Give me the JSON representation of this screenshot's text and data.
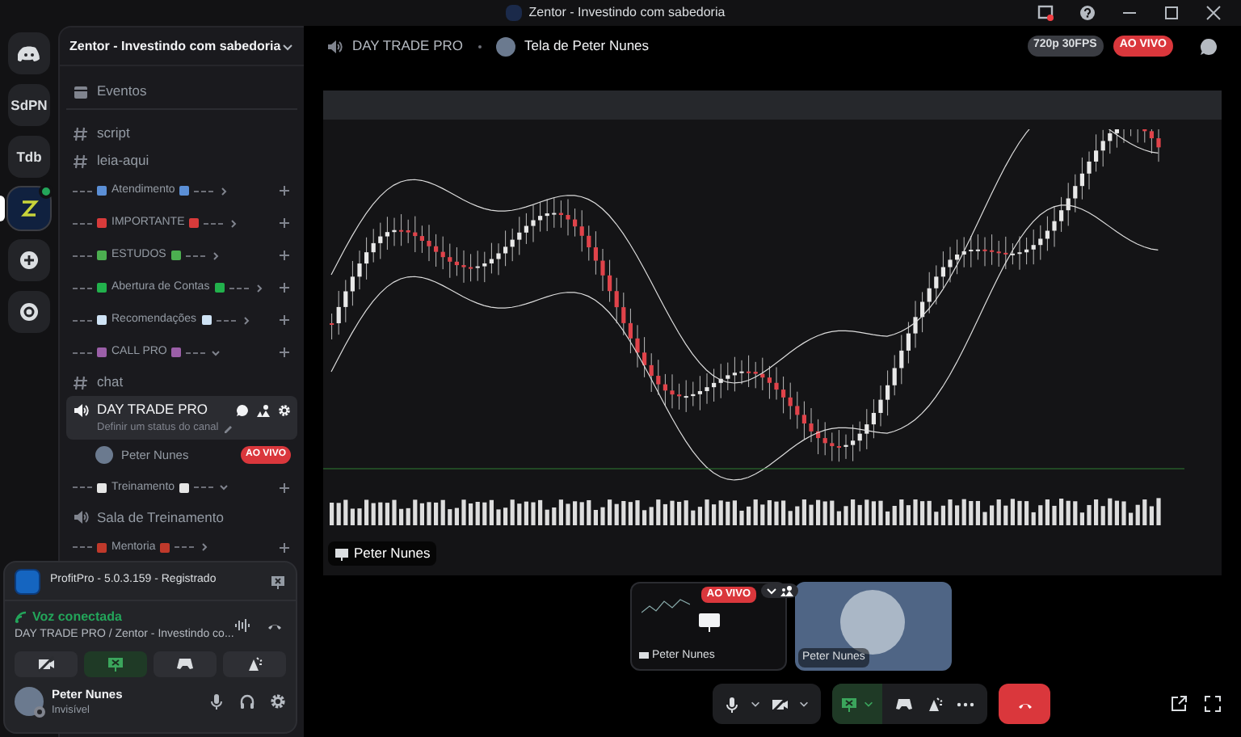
{
  "window": {
    "title": "Zentor - Investindo com sabedoria"
  },
  "servers": [
    {
      "kind": "home",
      "selected": false
    },
    {
      "kind": "text",
      "label": "SdPN",
      "selected": false
    },
    {
      "kind": "text",
      "label": "Tdb",
      "selected": false
    },
    {
      "kind": "image",
      "selected": true
    },
    {
      "kind": "add",
      "selected": false
    },
    {
      "kind": "discover",
      "selected": false
    }
  ],
  "server_name": "Zentor - Investindo com sabedoria",
  "channels": [
    {
      "kind": "event",
      "label": "Eventos"
    },
    {
      "kind": "text",
      "label": "script"
    },
    {
      "kind": "text",
      "label": "leia-aqui"
    },
    {
      "kind": "category",
      "label": "Atendimento",
      "color": "#5b8fd6",
      "expanded": false
    },
    {
      "kind": "category",
      "label": "IMPORTANTE",
      "color": "#d83b3b",
      "expanded": false
    },
    {
      "kind": "category",
      "label": "ESTUDOS",
      "color": "#4caf50",
      "expanded": false
    },
    {
      "kind": "category",
      "label": "Abertura de Contas",
      "color": "#22b14c",
      "expanded": false
    },
    {
      "kind": "category",
      "label": "Recomendações",
      "color": "#cfe3f5",
      "expanded": false
    },
    {
      "kind": "category",
      "label": "CALL PRO",
      "color": "#9b5fa8",
      "expanded": true
    },
    {
      "kind": "text",
      "label": "chat"
    },
    {
      "kind": "voice",
      "label": "DAY TRADE PRO",
      "selected": true,
      "status_placeholder": "Definir um status do canal",
      "users": [
        {
          "name": "Peter Nunes",
          "badge": "AO VIVO"
        }
      ]
    },
    {
      "kind": "category",
      "label": "Treinamento",
      "color": "#e6e6e6",
      "expanded": true
    },
    {
      "kind": "voice",
      "label": "Sala de Treinamento",
      "selected": false
    },
    {
      "kind": "category",
      "label": "Mentoria",
      "color": "#c0392b",
      "expanded": false
    }
  ],
  "activity": {
    "app": "ProfitPro - 5.0.3.159 - Registrado"
  },
  "voice": {
    "status": "Voz conectada",
    "channel": "DAY TRADE PRO / Zentor - Investindo co..."
  },
  "voice_buttons": [
    {
      "kind": "camera",
      "selected": false
    },
    {
      "kind": "screen",
      "selected": true
    },
    {
      "kind": "game",
      "selected": false
    },
    {
      "kind": "effects",
      "selected": false
    }
  ],
  "user": {
    "name": "Peter Nunes",
    "status": "Invisível"
  },
  "stream_header": {
    "channel": "DAY TRADE PRO",
    "title": "Tela de Peter Nunes",
    "quality": "720p 30FPS",
    "live": "AO VIVO"
  },
  "stream": {
    "label": "Peter Nunes"
  },
  "tiles": [
    {
      "kind": "screen",
      "label": "Peter Nunes",
      "badge": "AO VIVO"
    },
    {
      "kind": "camera",
      "label": "Peter Nunes"
    }
  ],
  "controls": {
    "screen_share_on": true
  }
}
